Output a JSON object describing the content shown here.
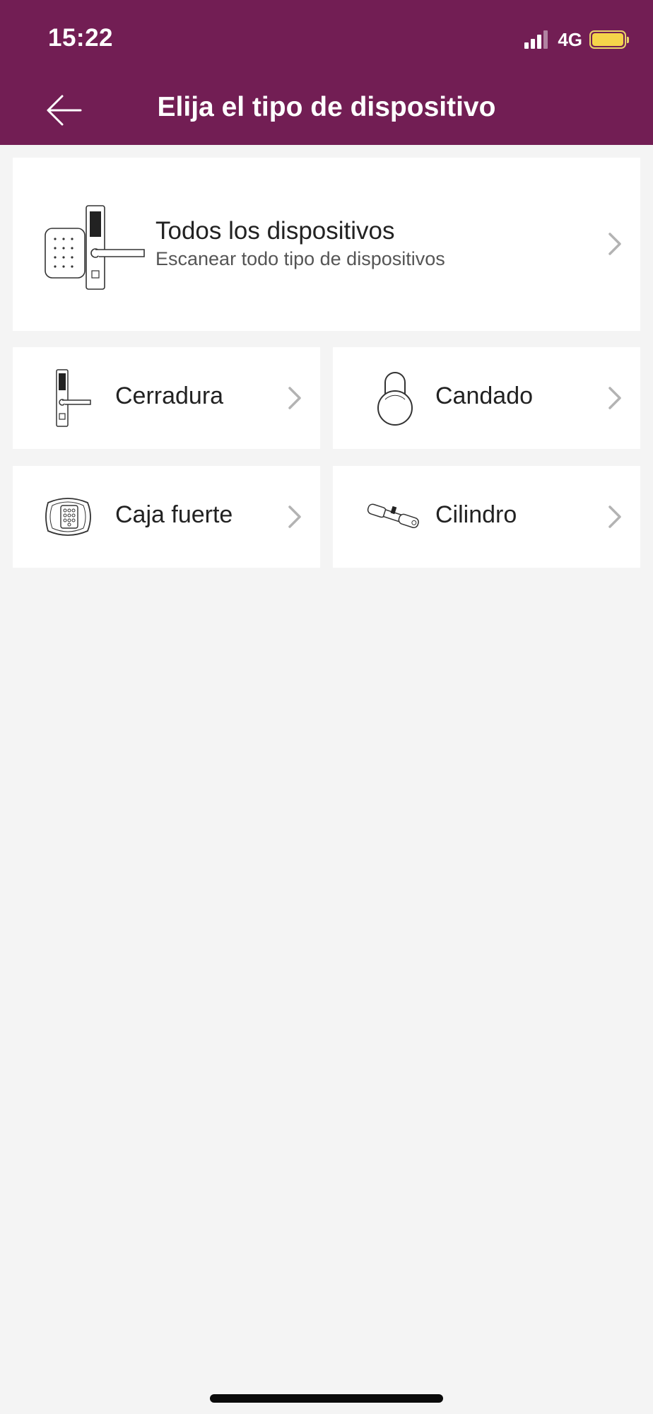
{
  "status_bar": {
    "time": "15:22",
    "network": "4G"
  },
  "header": {
    "title": "Elija el tipo de dispositivo",
    "back_icon": "arrow-left-icon"
  },
  "colors": {
    "header_bg": "#721e54",
    "background": "#f4f4f4",
    "battery": "#f5d44a"
  },
  "all_devices": {
    "title": "Todos los dispositivos",
    "subtitle": "Escanear todo tipo de dispositivos",
    "icon": "keypad-door-lock-icon"
  },
  "device_types": [
    {
      "label": "Cerradura",
      "icon": "door-lock-icon"
    },
    {
      "label": "Candado",
      "icon": "padlock-icon"
    },
    {
      "label": "Caja fuerte",
      "icon": "safe-icon"
    },
    {
      "label": "Cilindro",
      "icon": "cylinder-lock-icon"
    }
  ]
}
